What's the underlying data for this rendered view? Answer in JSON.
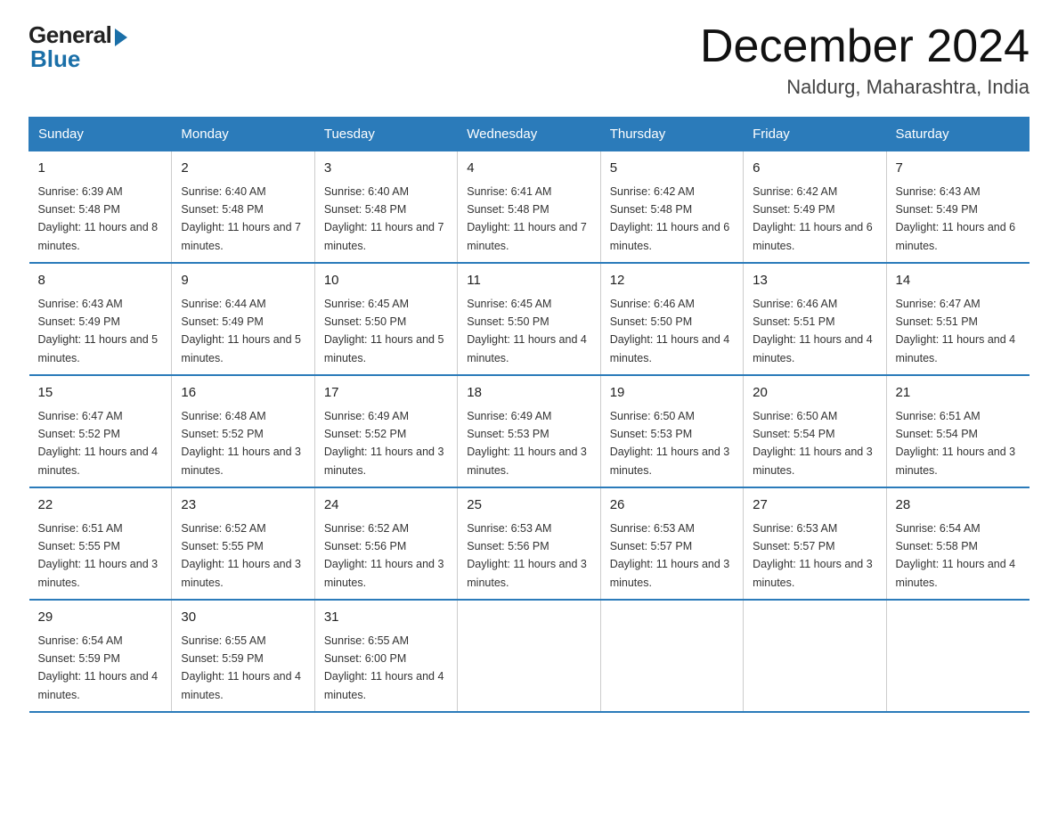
{
  "logo": {
    "general": "General",
    "blue": "Blue"
  },
  "title": {
    "month_year": "December 2024",
    "location": "Naldurg, Maharashtra, India"
  },
  "headers": [
    "Sunday",
    "Monday",
    "Tuesday",
    "Wednesday",
    "Thursday",
    "Friday",
    "Saturday"
  ],
  "weeks": [
    [
      {
        "day": "1",
        "sunrise": "6:39 AM",
        "sunset": "5:48 PM",
        "daylight": "11 hours and 8 minutes."
      },
      {
        "day": "2",
        "sunrise": "6:40 AM",
        "sunset": "5:48 PM",
        "daylight": "11 hours and 7 minutes."
      },
      {
        "day": "3",
        "sunrise": "6:40 AM",
        "sunset": "5:48 PM",
        "daylight": "11 hours and 7 minutes."
      },
      {
        "day": "4",
        "sunrise": "6:41 AM",
        "sunset": "5:48 PM",
        "daylight": "11 hours and 7 minutes."
      },
      {
        "day": "5",
        "sunrise": "6:42 AM",
        "sunset": "5:48 PM",
        "daylight": "11 hours and 6 minutes."
      },
      {
        "day": "6",
        "sunrise": "6:42 AM",
        "sunset": "5:49 PM",
        "daylight": "11 hours and 6 minutes."
      },
      {
        "day": "7",
        "sunrise": "6:43 AM",
        "sunset": "5:49 PM",
        "daylight": "11 hours and 6 minutes."
      }
    ],
    [
      {
        "day": "8",
        "sunrise": "6:43 AM",
        "sunset": "5:49 PM",
        "daylight": "11 hours and 5 minutes."
      },
      {
        "day": "9",
        "sunrise": "6:44 AM",
        "sunset": "5:49 PM",
        "daylight": "11 hours and 5 minutes."
      },
      {
        "day": "10",
        "sunrise": "6:45 AM",
        "sunset": "5:50 PM",
        "daylight": "11 hours and 5 minutes."
      },
      {
        "day": "11",
        "sunrise": "6:45 AM",
        "sunset": "5:50 PM",
        "daylight": "11 hours and 4 minutes."
      },
      {
        "day": "12",
        "sunrise": "6:46 AM",
        "sunset": "5:50 PM",
        "daylight": "11 hours and 4 minutes."
      },
      {
        "day": "13",
        "sunrise": "6:46 AM",
        "sunset": "5:51 PM",
        "daylight": "11 hours and 4 minutes."
      },
      {
        "day": "14",
        "sunrise": "6:47 AM",
        "sunset": "5:51 PM",
        "daylight": "11 hours and 4 minutes."
      }
    ],
    [
      {
        "day": "15",
        "sunrise": "6:47 AM",
        "sunset": "5:52 PM",
        "daylight": "11 hours and 4 minutes."
      },
      {
        "day": "16",
        "sunrise": "6:48 AM",
        "sunset": "5:52 PM",
        "daylight": "11 hours and 3 minutes."
      },
      {
        "day": "17",
        "sunrise": "6:49 AM",
        "sunset": "5:52 PM",
        "daylight": "11 hours and 3 minutes."
      },
      {
        "day": "18",
        "sunrise": "6:49 AM",
        "sunset": "5:53 PM",
        "daylight": "11 hours and 3 minutes."
      },
      {
        "day": "19",
        "sunrise": "6:50 AM",
        "sunset": "5:53 PM",
        "daylight": "11 hours and 3 minutes."
      },
      {
        "day": "20",
        "sunrise": "6:50 AM",
        "sunset": "5:54 PM",
        "daylight": "11 hours and 3 minutes."
      },
      {
        "day": "21",
        "sunrise": "6:51 AM",
        "sunset": "5:54 PM",
        "daylight": "11 hours and 3 minutes."
      }
    ],
    [
      {
        "day": "22",
        "sunrise": "6:51 AM",
        "sunset": "5:55 PM",
        "daylight": "11 hours and 3 minutes."
      },
      {
        "day": "23",
        "sunrise": "6:52 AM",
        "sunset": "5:55 PM",
        "daylight": "11 hours and 3 minutes."
      },
      {
        "day": "24",
        "sunrise": "6:52 AM",
        "sunset": "5:56 PM",
        "daylight": "11 hours and 3 minutes."
      },
      {
        "day": "25",
        "sunrise": "6:53 AM",
        "sunset": "5:56 PM",
        "daylight": "11 hours and 3 minutes."
      },
      {
        "day": "26",
        "sunrise": "6:53 AM",
        "sunset": "5:57 PM",
        "daylight": "11 hours and 3 minutes."
      },
      {
        "day": "27",
        "sunrise": "6:53 AM",
        "sunset": "5:57 PM",
        "daylight": "11 hours and 3 minutes."
      },
      {
        "day": "28",
        "sunrise": "6:54 AM",
        "sunset": "5:58 PM",
        "daylight": "11 hours and 4 minutes."
      }
    ],
    [
      {
        "day": "29",
        "sunrise": "6:54 AM",
        "sunset": "5:59 PM",
        "daylight": "11 hours and 4 minutes."
      },
      {
        "day": "30",
        "sunrise": "6:55 AM",
        "sunset": "5:59 PM",
        "daylight": "11 hours and 4 minutes."
      },
      {
        "day": "31",
        "sunrise": "6:55 AM",
        "sunset": "6:00 PM",
        "daylight": "11 hours and 4 minutes."
      },
      null,
      null,
      null,
      null
    ]
  ]
}
